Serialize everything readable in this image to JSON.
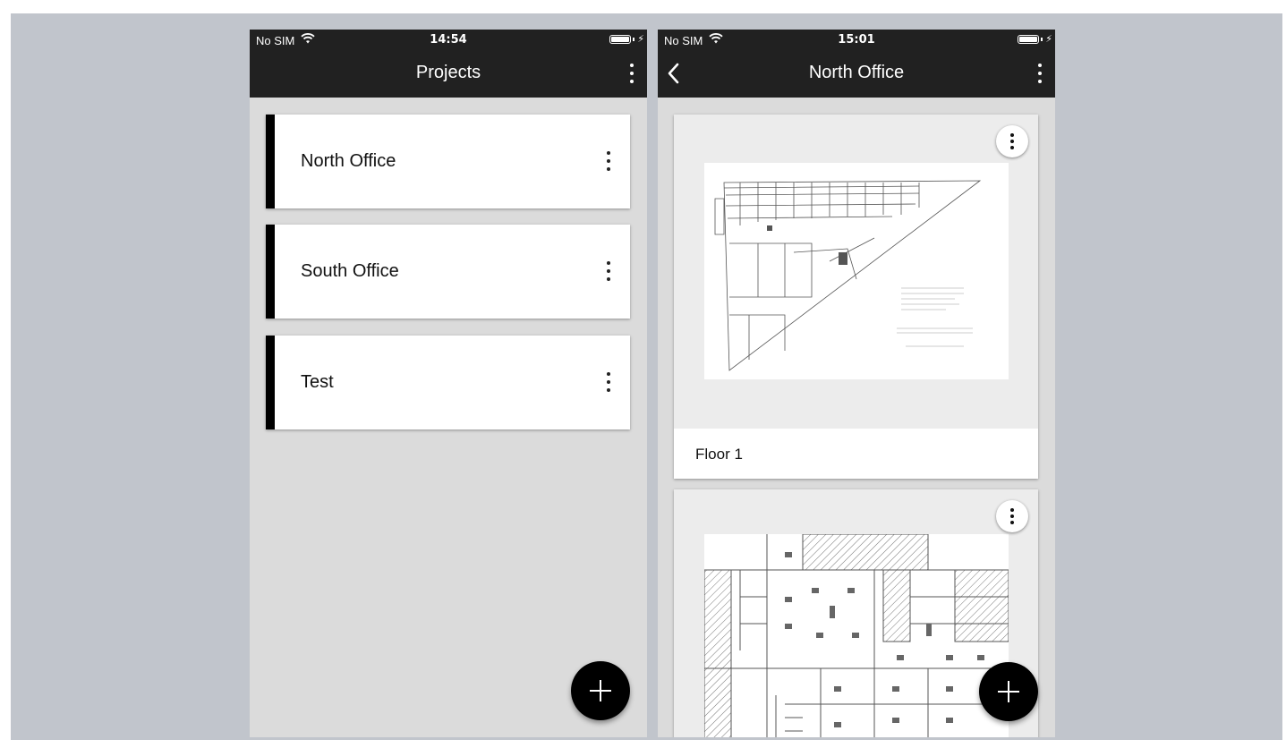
{
  "left_screen": {
    "status": {
      "carrier": "No SIM",
      "time": "14:54"
    },
    "title": "Projects",
    "projects": [
      {
        "label": "North Office"
      },
      {
        "label": "South Office"
      },
      {
        "label": "Test"
      }
    ]
  },
  "right_screen": {
    "status": {
      "carrier": "No SIM",
      "time": "15:01"
    },
    "title": "North Office",
    "floors": [
      {
        "label": "Floor 1"
      },
      {
        "label": ""
      }
    ]
  },
  "icons": {
    "wifi": "wifi-icon",
    "battery": "battery-icon",
    "charging": "bolt-icon",
    "menu": "more-vert-icon",
    "back": "chevron-left-icon",
    "add": "plus-icon"
  },
  "colors": {
    "app_bar": "#212121",
    "background": "#dbdbdb",
    "card_accent": "#000000",
    "fab": "#000000",
    "outer_bg": "#c1c5cc"
  }
}
